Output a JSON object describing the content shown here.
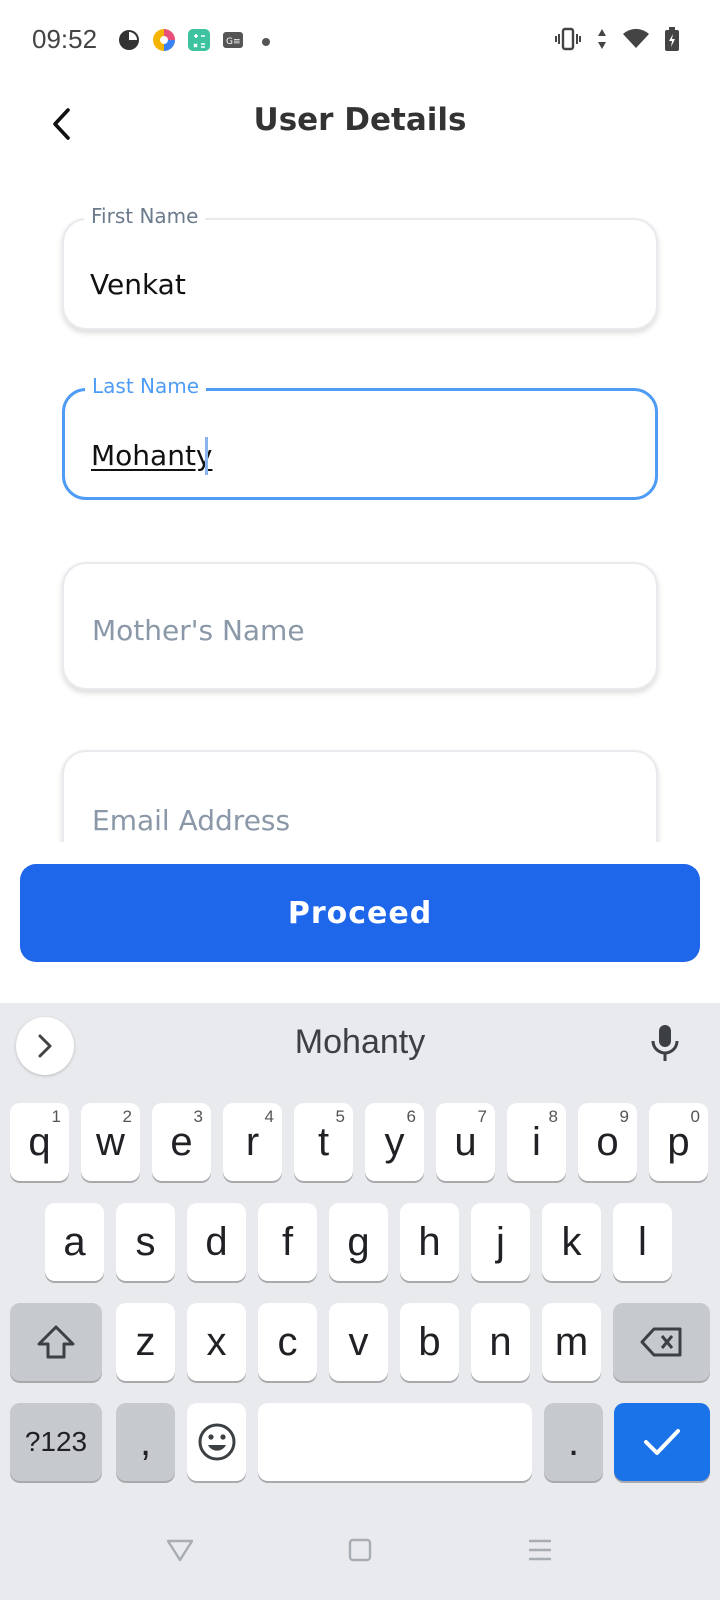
{
  "status": {
    "time": "09:52",
    "notification_icons": [
      {
        "name": "pie-app-icon",
        "color": "#333333"
      },
      {
        "name": "multicolor-app-icon",
        "color": "#e94f7b"
      },
      {
        "name": "calculator-app-icon",
        "color": "#3ec3a0"
      },
      {
        "name": "gmail-g-app-icon",
        "color": "#555555"
      }
    ],
    "system_icons": [
      "vibrate-icon",
      "data-arrows-icon",
      "wifi-icon",
      "battery-charging-icon"
    ]
  },
  "header": {
    "title": "User Details",
    "back_icon": "chevron-left-icon"
  },
  "form": {
    "first_name": {
      "label": "First Name",
      "value": "Venkat"
    },
    "last_name": {
      "label": "Last Name",
      "value": "Mohanty"
    },
    "mothers_name": {
      "placeholder": "Mother's Name"
    },
    "email": {
      "placeholder": "Email Address"
    }
  },
  "proceed_label": "Proceed",
  "keyboard": {
    "suggestion": "Mohanty",
    "row1": [
      {
        "k": "q",
        "h": "1"
      },
      {
        "k": "w",
        "h": "2"
      },
      {
        "k": "e",
        "h": "3"
      },
      {
        "k": "r",
        "h": "4"
      },
      {
        "k": "t",
        "h": "5"
      },
      {
        "k": "y",
        "h": "6"
      },
      {
        "k": "u",
        "h": "7"
      },
      {
        "k": "i",
        "h": "8"
      },
      {
        "k": "o",
        "h": "9"
      },
      {
        "k": "p",
        "h": "0"
      }
    ],
    "row2": [
      "a",
      "s",
      "d",
      "f",
      "g",
      "h",
      "j",
      "k",
      "l"
    ],
    "row3": [
      "z",
      "x",
      "c",
      "v",
      "b",
      "n",
      "m"
    ],
    "symbols_label": "?123",
    "comma_label": ",",
    "period_label": "."
  },
  "colors": {
    "accent": "#1f67ea",
    "focus": "#4e9cf4",
    "enter_key": "#1a73e8"
  }
}
